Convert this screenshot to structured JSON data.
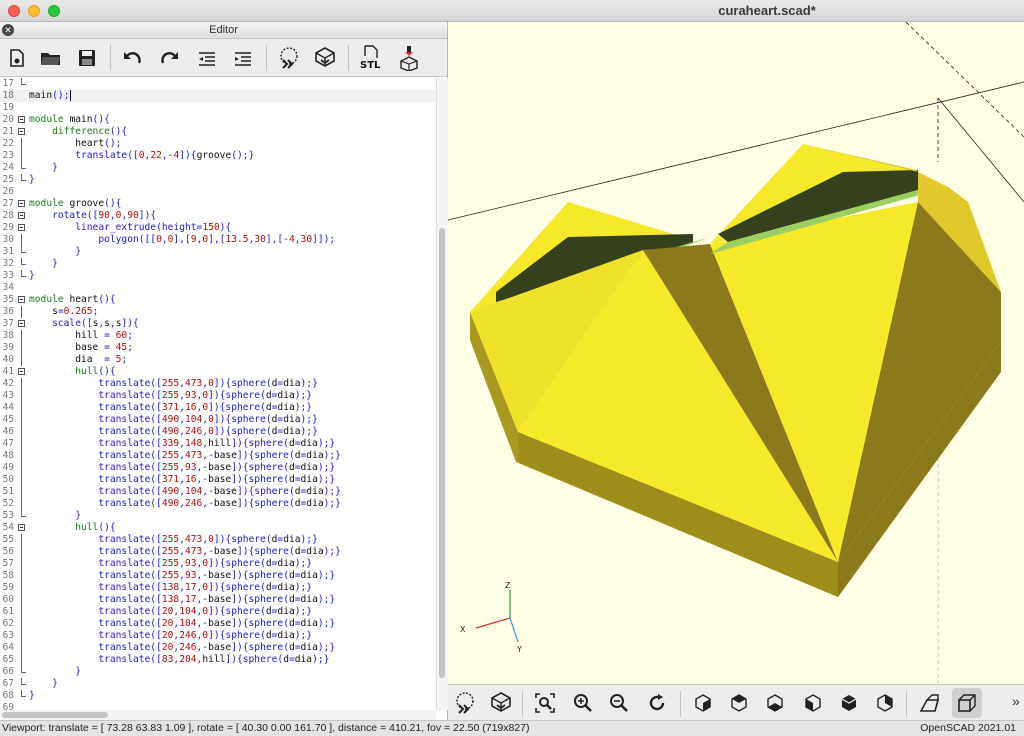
{
  "window": {
    "title": "curaheart.scad*"
  },
  "editor": {
    "title": "Editor",
    "toolbar": [
      {
        "icon": "new-file-icon",
        "label": "New"
      },
      {
        "icon": "open-folder-icon",
        "label": "Open"
      },
      {
        "icon": "save-icon",
        "label": "Save"
      },
      {
        "icon": "undo-icon",
        "label": "Undo"
      },
      {
        "icon": "redo-icon",
        "label": "Redo"
      },
      {
        "icon": "unindent-icon",
        "label": "Unindent"
      },
      {
        "icon": "indent-icon",
        "label": "Indent"
      },
      {
        "icon": "preview-icon",
        "label": "Preview"
      },
      {
        "icon": "render-icon",
        "label": "Render"
      },
      {
        "icon": "stl-export-icon",
        "label": "STL"
      },
      {
        "icon": "send-to-print-icon",
        "label": "Send to 3D print"
      }
    ],
    "stl_label": "STL",
    "current_line": 18,
    "lines": [
      {
        "n": 17,
        "code": "",
        "fold": "end"
      },
      {
        "n": 18,
        "code": "main();",
        "fold": ""
      },
      {
        "n": 19,
        "code": "",
        "fold": ""
      },
      {
        "n": 20,
        "code": "module main(){",
        "fold": "open"
      },
      {
        "n": 21,
        "code": "    difference(){",
        "fold": "open"
      },
      {
        "n": 22,
        "code": "        heart();",
        "fold": ""
      },
      {
        "n": 23,
        "code": "        translate([0,22,-4]){groove();}",
        "fold": ""
      },
      {
        "n": 24,
        "code": "    }",
        "fold": "end"
      },
      {
        "n": 25,
        "code": "}",
        "fold": "end"
      },
      {
        "n": 26,
        "code": "",
        "fold": ""
      },
      {
        "n": 27,
        "code": "module groove(){",
        "fold": "open"
      },
      {
        "n": 28,
        "code": "    rotate([90,0,90]){",
        "fold": "open"
      },
      {
        "n": 29,
        "code": "        linear_extrude(height=150){",
        "fold": "open"
      },
      {
        "n": 30,
        "code": "            polygon([[0,0],[9,0],[13.5,30],[-4,30]]);",
        "fold": ""
      },
      {
        "n": 31,
        "code": "        }",
        "fold": "end"
      },
      {
        "n": 32,
        "code": "    }",
        "fold": "end"
      },
      {
        "n": 33,
        "code": "}",
        "fold": "end"
      },
      {
        "n": 34,
        "code": "",
        "fold": ""
      },
      {
        "n": 35,
        "code": "module heart(){",
        "fold": "open"
      },
      {
        "n": 36,
        "code": "    s=0.265;",
        "fold": ""
      },
      {
        "n": 37,
        "code": "    scale([s,s,s]){",
        "fold": "open"
      },
      {
        "n": 38,
        "code": "        hill = 60;",
        "fold": ""
      },
      {
        "n": 39,
        "code": "        base = 45;",
        "fold": ""
      },
      {
        "n": 40,
        "code": "        dia  = 5;",
        "fold": ""
      },
      {
        "n": 41,
        "code": "        hull(){",
        "fold": "open"
      },
      {
        "n": 42,
        "code": "            translate([255,473,0]){sphere(d=dia);}",
        "fold": ""
      },
      {
        "n": 43,
        "code": "            translate([255,93,0]){sphere(d=dia);}",
        "fold": ""
      },
      {
        "n": 44,
        "code": "            translate([371,16,0]){sphere(d=dia);}",
        "fold": ""
      },
      {
        "n": 45,
        "code": "            translate([490,104,0]){sphere(d=dia);}",
        "fold": ""
      },
      {
        "n": 46,
        "code": "            translate([490,246,0]){sphere(d=dia);}",
        "fold": ""
      },
      {
        "n": 47,
        "code": "            translate([339,148,hill]){sphere(d=dia);}",
        "fold": ""
      },
      {
        "n": 48,
        "code": "            translate([255,473,-base]){sphere(d=dia);}",
        "fold": ""
      },
      {
        "n": 49,
        "code": "            translate([255,93,-base]){sphere(d=dia);}",
        "fold": ""
      },
      {
        "n": 50,
        "code": "            translate([371,16,-base]){sphere(d=dia);}",
        "fold": ""
      },
      {
        "n": 51,
        "code": "            translate([490,104,-base]){sphere(d=dia);}",
        "fold": ""
      },
      {
        "n": 52,
        "code": "            translate([490,246,-base]){sphere(d=dia);}",
        "fold": ""
      },
      {
        "n": 53,
        "code": "        }",
        "fold": "end"
      },
      {
        "n": 54,
        "code": "        hull(){",
        "fold": "open"
      },
      {
        "n": 55,
        "code": "            translate([255,473,0]){sphere(d=dia);}",
        "fold": ""
      },
      {
        "n": 56,
        "code": "            translate([255,473,-base]){sphere(d=dia);}",
        "fold": ""
      },
      {
        "n": 57,
        "code": "            translate([255,93,0]){sphere(d=dia);}",
        "fold": ""
      },
      {
        "n": 58,
        "code": "            translate([255,93,-base]){sphere(d=dia);}",
        "fold": ""
      },
      {
        "n": 59,
        "code": "            translate([138,17,0]){sphere(d=dia);}",
        "fold": ""
      },
      {
        "n": 60,
        "code": "            translate([138,17,-base]){sphere(d=dia);}",
        "fold": ""
      },
      {
        "n": 61,
        "code": "            translate([20,104,0]){sphere(d=dia);}",
        "fold": ""
      },
      {
        "n": 62,
        "code": "            translate([20,104,-base]){sphere(d=dia);}",
        "fold": ""
      },
      {
        "n": 63,
        "code": "            translate([20,246,0]){sphere(d=dia);}",
        "fold": ""
      },
      {
        "n": 64,
        "code": "            translate([20,246,-base]){sphere(d=dia);}",
        "fold": ""
      },
      {
        "n": 65,
        "code": "            translate([83,204,hill]){sphere(d=dia);}",
        "fold": ""
      },
      {
        "n": 66,
        "code": "        }",
        "fold": "end"
      },
      {
        "n": 67,
        "code": "    }",
        "fold": "end"
      },
      {
        "n": 68,
        "code": "}",
        "fold": "end"
      },
      {
        "n": 69,
        "code": "",
        "fold": ""
      }
    ]
  },
  "syntax_colors": {
    "keyword": "#1a7a1a",
    "builtin": "#1c1cc8",
    "number": "#b01010",
    "default": "#111111"
  },
  "viewport": {
    "background": "#ffffe5",
    "axes": {
      "x": "X",
      "y": "Y",
      "z": "Z"
    },
    "model_colors": {
      "light": "#f5e92a",
      "mid": "#e2cc2a",
      "dark": "#8a7a1c",
      "shadow": "#35401c",
      "groove": "#9ccf5f",
      "side": "#a89a20"
    },
    "toolbar": [
      {
        "icon": "preview-icon"
      },
      {
        "icon": "render-icon"
      },
      {
        "icon": "view-all-icon"
      },
      {
        "icon": "zoom-in-icon"
      },
      {
        "icon": "zoom-out-icon"
      },
      {
        "icon": "reset-view-icon"
      },
      {
        "icon": "view-right-icon"
      },
      {
        "icon": "view-top-icon"
      },
      {
        "icon": "view-bottom-icon"
      },
      {
        "icon": "view-left-icon"
      },
      {
        "icon": "view-front-icon"
      },
      {
        "icon": "view-back-icon"
      },
      {
        "icon": "perspective-icon"
      },
      {
        "icon": "orthogonal-icon"
      }
    ],
    "more": "»"
  },
  "status": {
    "left": "Viewport: translate = [ 73.28 63.83 1.09 ], rotate = [ 40.30 0.00 161.70 ], distance = 410.21, fov = 22.50 (719x827)",
    "right": "OpenSCAD 2021.01"
  }
}
